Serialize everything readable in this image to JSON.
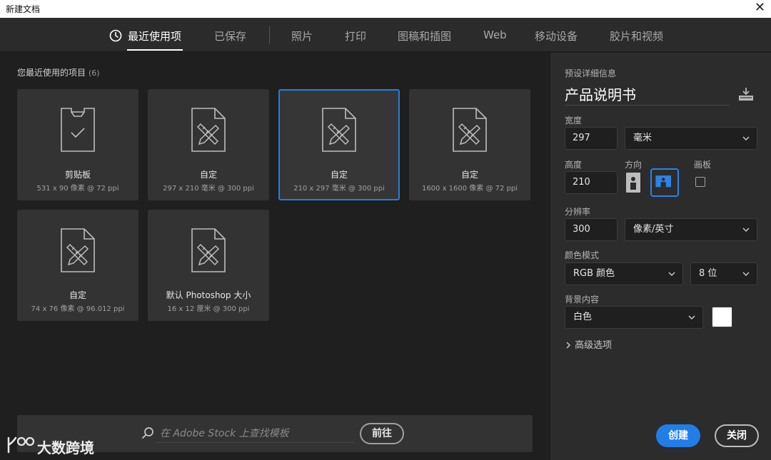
{
  "window": {
    "title": "新建文档",
    "close_glyph": "✕"
  },
  "tabs": [
    {
      "label": "最近使用项",
      "active": true
    },
    {
      "label": "已保存"
    },
    {
      "label": "照片"
    },
    {
      "label": "打印"
    },
    {
      "label": "图稿和插图"
    },
    {
      "label": "Web"
    },
    {
      "label": "移动设备"
    },
    {
      "label": "胶片和视频"
    }
  ],
  "recent": {
    "title": "您最近使用的项目",
    "count": "(6)",
    "items": [
      {
        "name": "剪贴板",
        "desc": "531 x 90 像素 @ 72 ppi",
        "icon": "clipboard-icon"
      },
      {
        "name": "自定",
        "desc": "297 x 210 毫米 @ 300 ppi",
        "icon": "document-ruler-icon"
      },
      {
        "name": "自定",
        "desc": "210 x 297 毫米 @ 300 ppi",
        "icon": "document-ruler-icon",
        "selected": true
      },
      {
        "name": "自定",
        "desc": "1600 x 1600 像素 @ 72 ppi",
        "icon": "document-ruler-icon"
      },
      {
        "name": "自定",
        "desc": "74 x 76 像素 @ 96.012 ppi",
        "icon": "document-ruler-icon"
      },
      {
        "name": "默认 Photoshop 大小",
        "desc": "16 x 12 厘米 @ 300 ppi",
        "icon": "document-ruler-icon"
      }
    ]
  },
  "stock": {
    "placeholder": "在 Adobe Stock 上查找模板",
    "go_label": "前往"
  },
  "watermark": {
    "text": "大数跨境"
  },
  "preset": {
    "header": "预设详细信息",
    "name": "产品说明书",
    "width_label": "宽度",
    "width_value": "297",
    "width_unit": "毫米",
    "height_label": "高度",
    "height_value": "210",
    "orientation_label": "方向",
    "orientation": "landscape",
    "artboard_label": "画板",
    "artboard_checked": false,
    "resolution_label": "分辨率",
    "resolution_value": "300",
    "resolution_unit": "像素/英寸",
    "color_mode_label": "颜色模式",
    "color_mode": "RGB 颜色",
    "bit_depth": "8 位",
    "background_label": "背景内容",
    "background": "白色",
    "background_color": "#ffffff",
    "advanced_label": "高级选项"
  },
  "buttons": {
    "create": "创建",
    "close": "关闭"
  },
  "colors": {
    "accent": "#1f7ee8"
  }
}
